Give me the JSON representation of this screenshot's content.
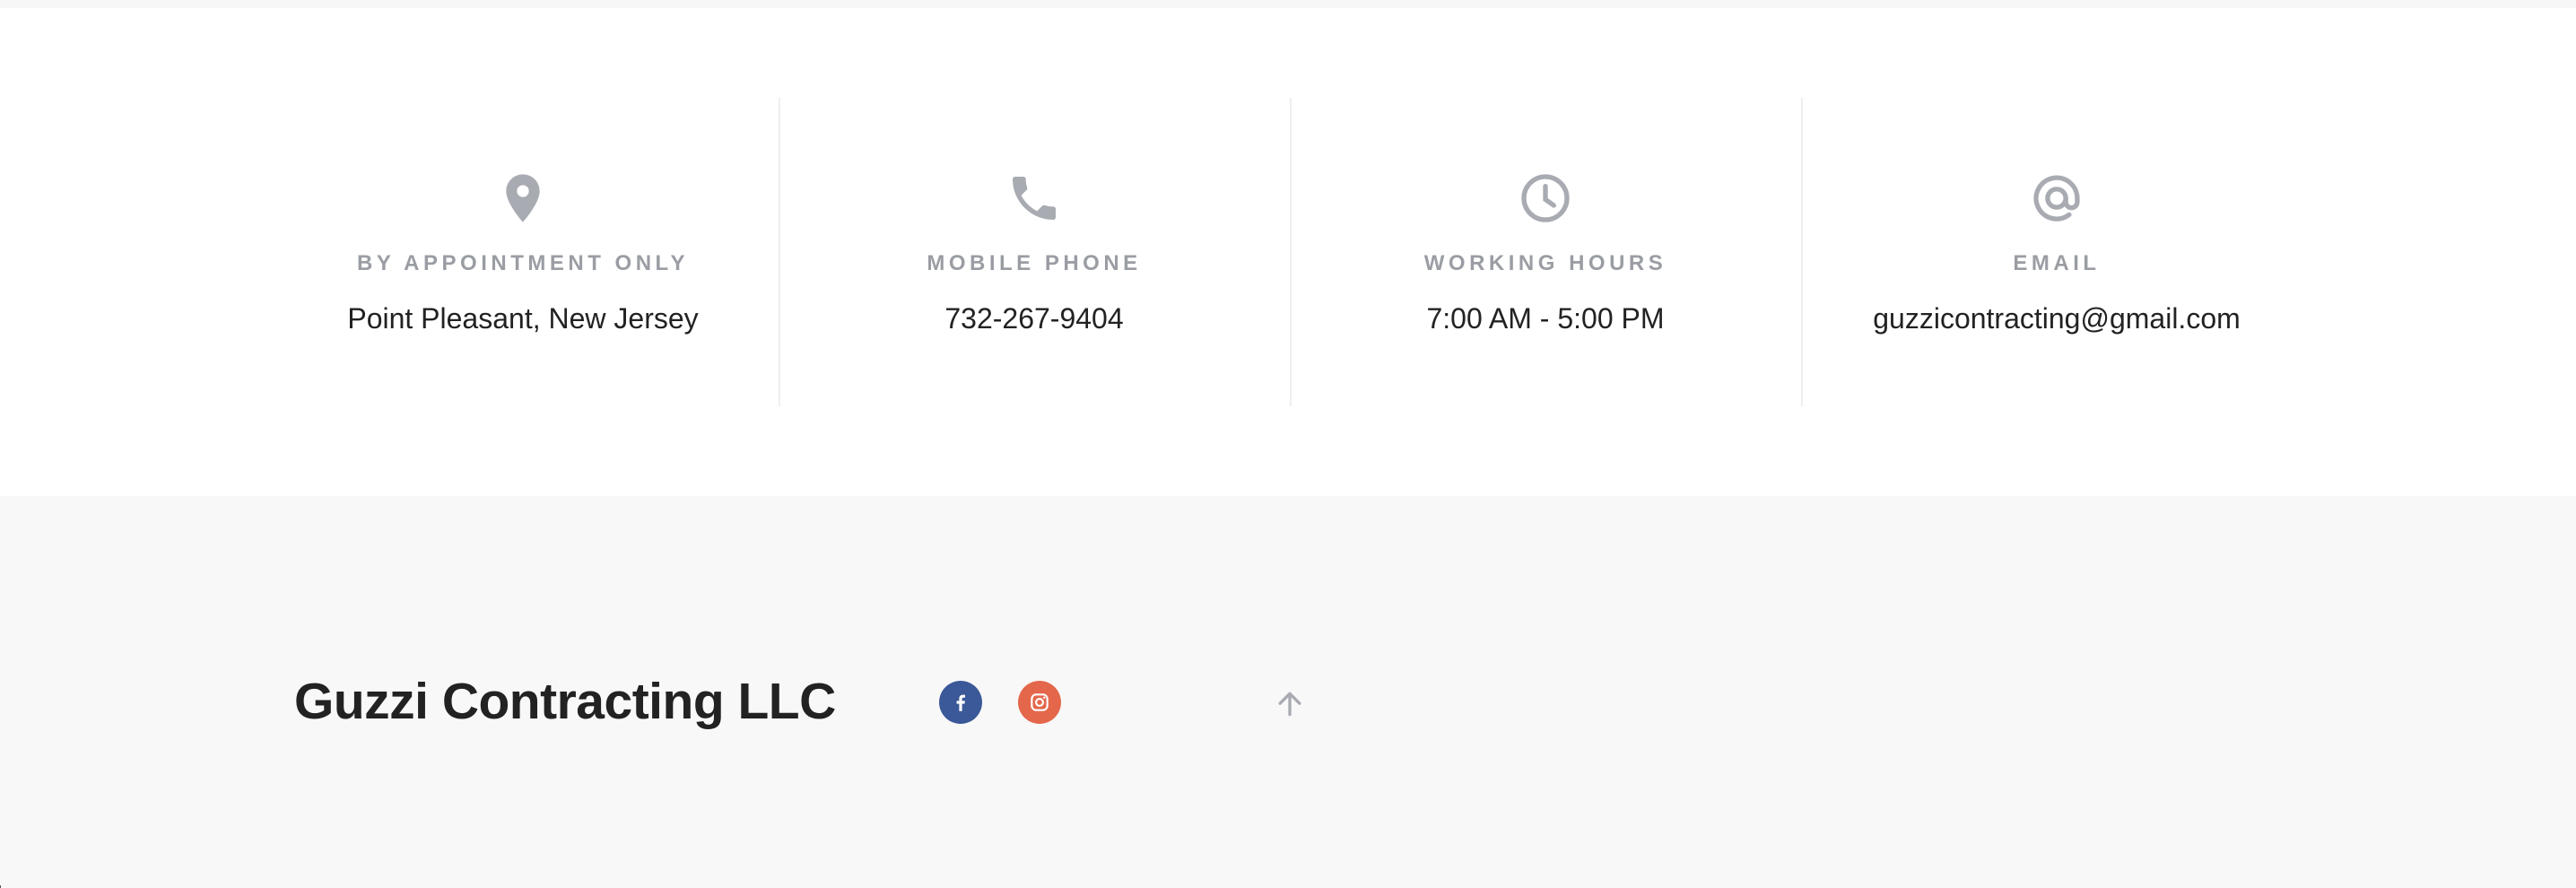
{
  "contacts": [
    {
      "label": "BY APPOINTMENT ONLY",
      "value": "Point Pleasant, New Jersey",
      "icon": "map-pin-icon"
    },
    {
      "label": "MOBILE PHONE",
      "value": "732-267-9404",
      "icon": "phone-icon"
    },
    {
      "label": "WORKING HOURS",
      "value": "7:00 AM - 5:00 PM",
      "icon": "clock-icon"
    },
    {
      "label": "EMAIL",
      "value": "guzzicontracting@gmail.com",
      "icon": "at-sign-icon"
    }
  ],
  "footer": {
    "brand": "Guzzi Contracting LLC",
    "social": [
      {
        "name": "facebook",
        "icon": "facebook-icon",
        "color": "#3b5998"
      },
      {
        "name": "instagram",
        "icon": "instagram-icon",
        "color": "#e4674b"
      }
    ],
    "back_to_top_icon": "arrow-up-icon"
  },
  "colors": {
    "icon_gray": "#a8abb1",
    "label_gray": "#9a9da3",
    "text_dark": "#222222",
    "footer_bg": "#f8f8f8"
  }
}
